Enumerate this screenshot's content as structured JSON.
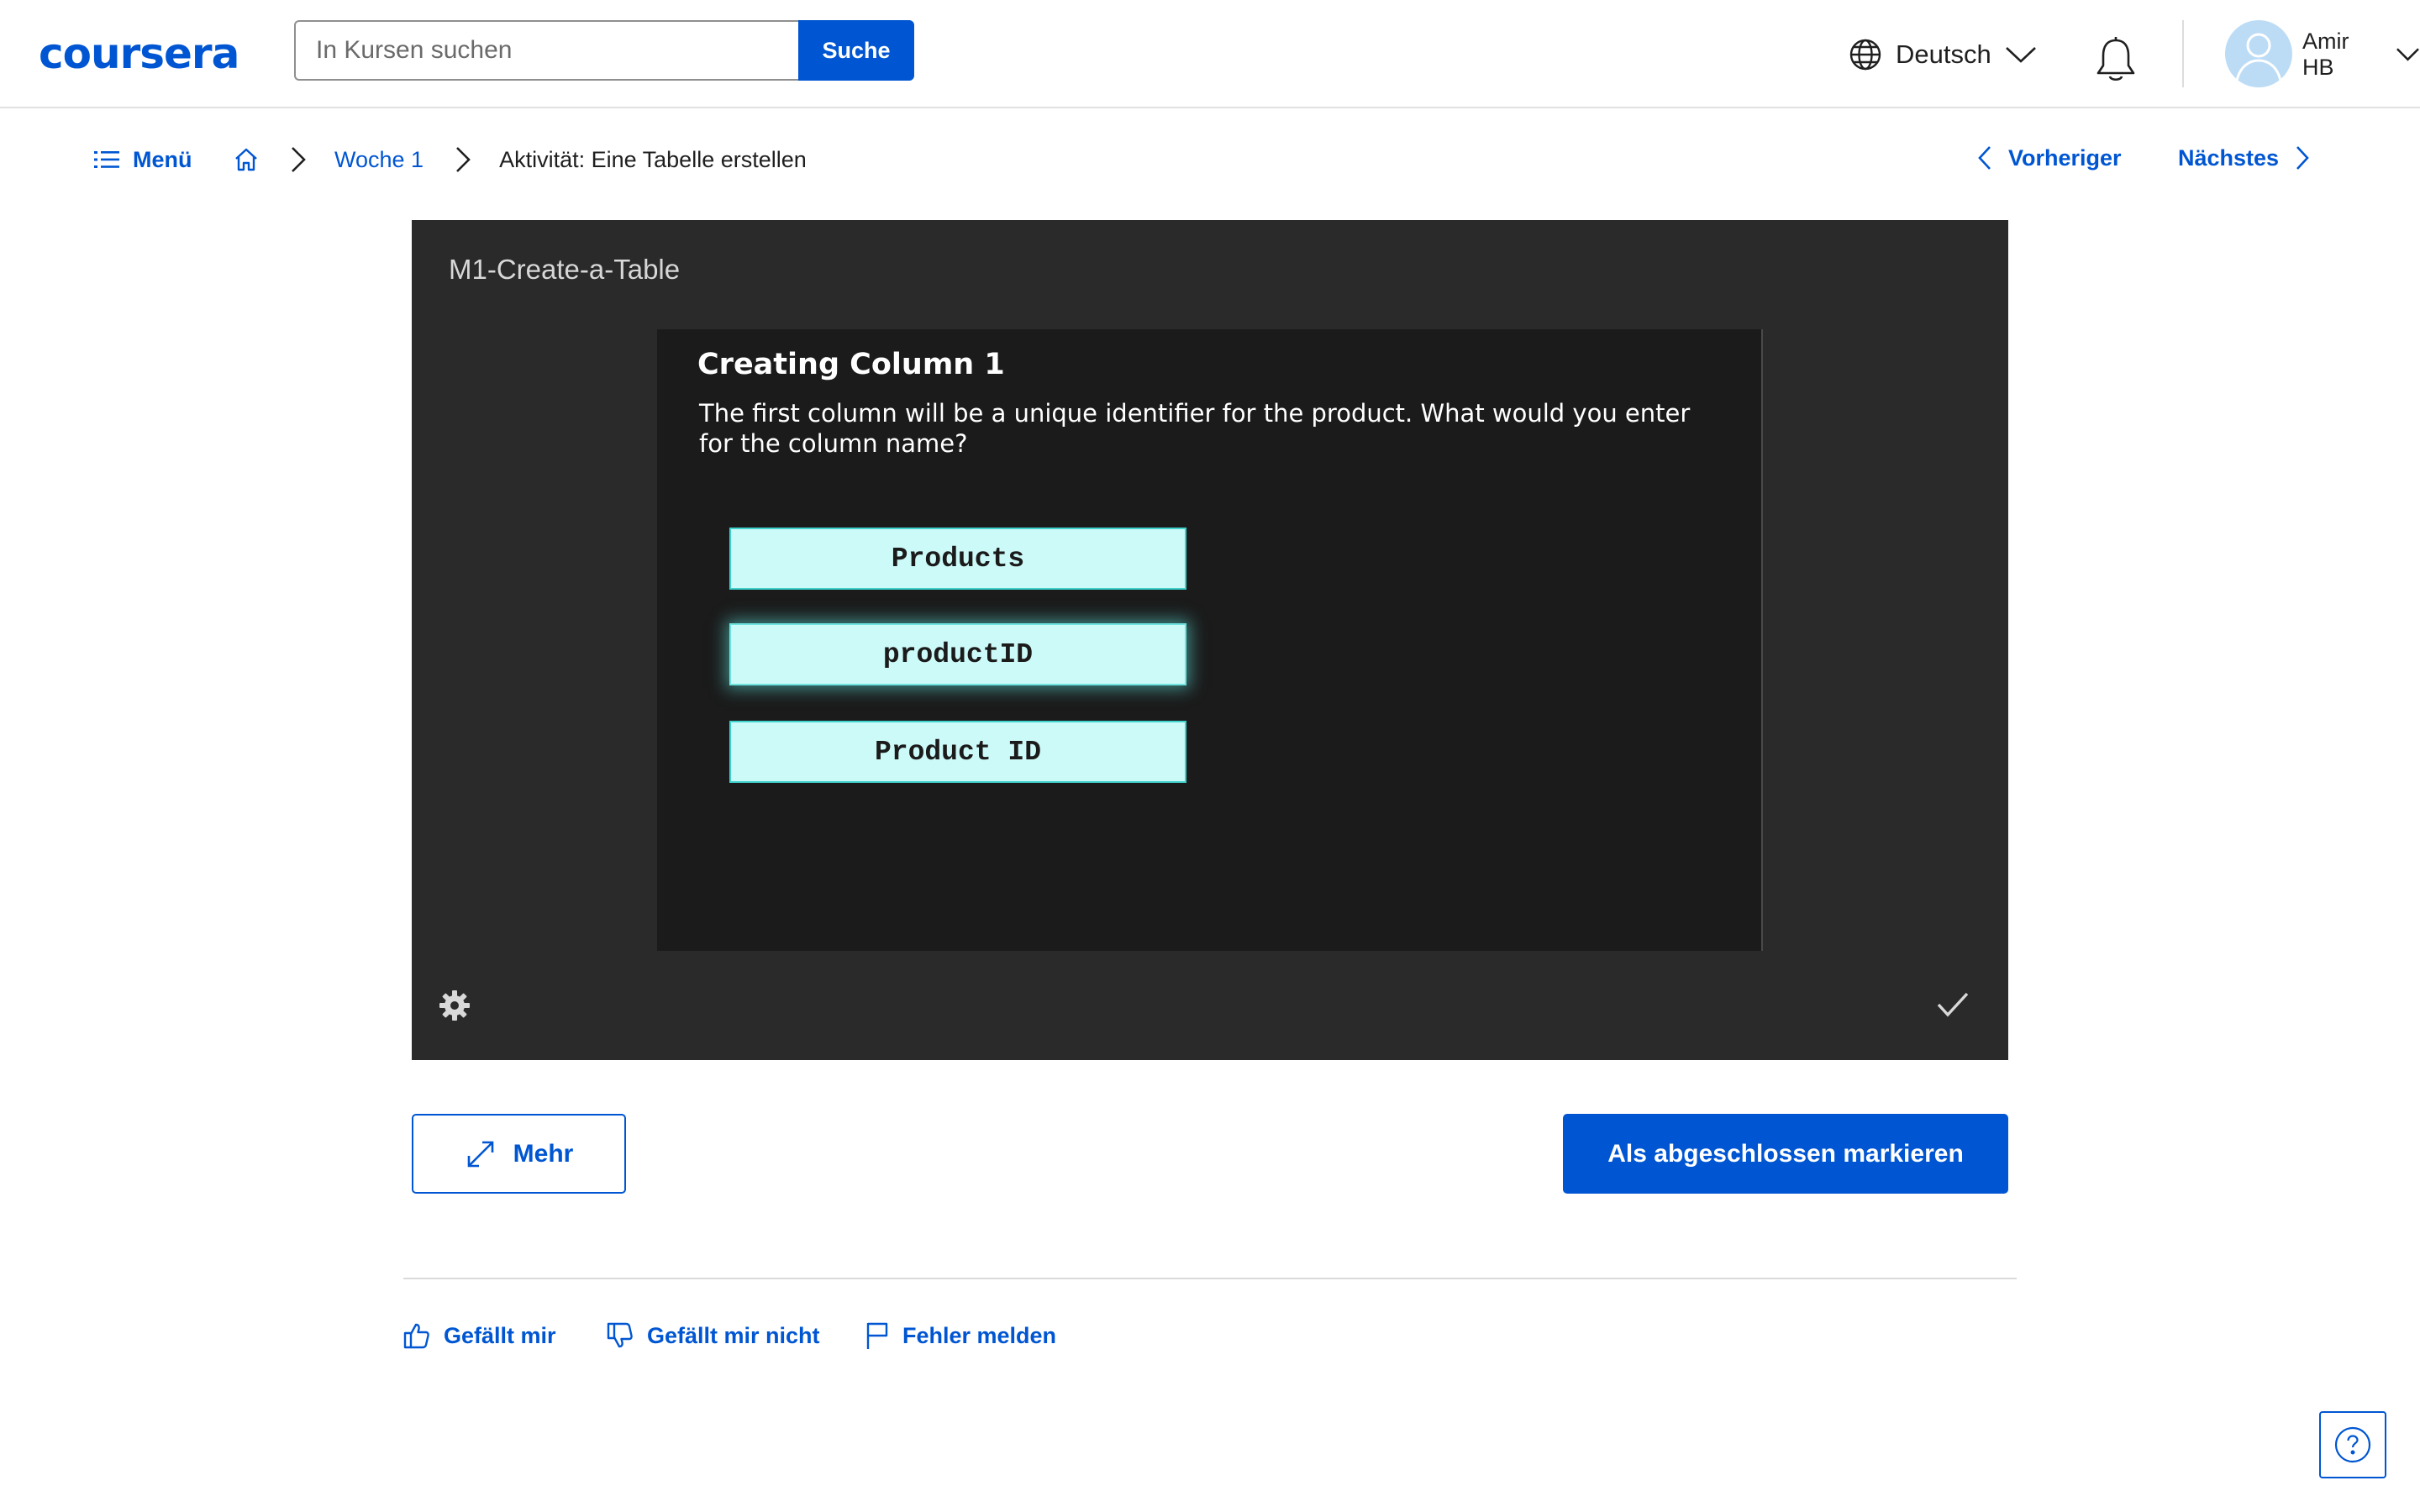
{
  "header": {
    "logo_text": "coursera",
    "search": {
      "placeholder": "In Kursen suchen",
      "value": "",
      "button_label": "Suche"
    },
    "language": {
      "label": "Deutsch",
      "icon": "globe-icon"
    },
    "notifications_icon": "bell-icon",
    "user": {
      "name": "Amir HB",
      "avatar_icon": "user-avatar-icon"
    }
  },
  "breadcrumb": {
    "menu_label": "Menü",
    "home_icon": "home-icon",
    "items": [
      {
        "label": "Woche 1",
        "link": true
      },
      {
        "label": "Aktivität: Eine Tabelle erstellen",
        "link": false
      }
    ]
  },
  "navigation": {
    "prev_label": "Vorheriger",
    "next_label": "Nächstes"
  },
  "player": {
    "title": "M1-Create-a-Table",
    "slide": {
      "heading": "Creating Column 1",
      "text": "The first column will be a unique identifier for the product. What would you enter for the column name?",
      "options": [
        "Products",
        "productID",
        "Product ID"
      ],
      "highlighted_option": "productID"
    },
    "settings_icon": "gear-icon",
    "complete_icon": "checkmark-icon"
  },
  "actions": {
    "more_label": "Mehr",
    "complete_label": "Als abgeschlossen markieren"
  },
  "feedback": {
    "like_label": "Gefällt mir",
    "dislike_label": "Gefällt mir nicht",
    "report_label": "Fehler melden"
  },
  "help_icon": "help-question-icon",
  "colors": {
    "primary": "#0056d2",
    "player_bg": "#2a2a2a",
    "slide_bg": "#1b1b1b",
    "option_bg": "#ccfaf8",
    "option_border": "#3fd1cc"
  }
}
